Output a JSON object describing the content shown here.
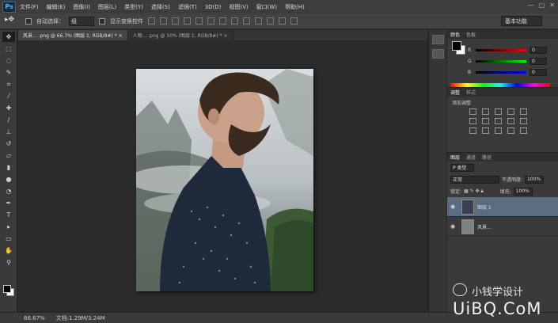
{
  "menubar": {
    "logo": "Ps",
    "items": [
      "文件(F)",
      "编辑(E)",
      "图像(I)",
      "图层(L)",
      "类型(Y)",
      "选择(S)",
      "滤镜(T)",
      "3D(D)",
      "视图(V)",
      "窗口(W)",
      "帮助(H)"
    ],
    "controls": [
      "—",
      "▢",
      "✕"
    ]
  },
  "options": {
    "auto_select": "自动选择：",
    "auto_select_value": "组",
    "show_transform": "显示变换控件",
    "workspace": "基本功能"
  },
  "tabs": [
    {
      "label": "风景... .png @ 66.7% (图层 1, RGB/8#) * ×",
      "active": true
    },
    {
      "label": "人物... .png @ 50% (图层 1, RGB/8#) * ×",
      "active": false
    }
  ],
  "panels": {
    "color_tabs": [
      "颜色",
      "色板"
    ],
    "sliders": [
      {
        "label": "R",
        "value": "0",
        "gradient": "linear-gradient(90deg,#000,#f00)"
      },
      {
        "label": "G",
        "value": "0",
        "gradient": "linear-gradient(90deg,#000,#0f0)"
      },
      {
        "label": "B",
        "value": "0",
        "gradient": "linear-gradient(90deg,#000,#00f)"
      }
    ],
    "adj_tabs": [
      "调整",
      "样式"
    ],
    "adj_title": "添加调整",
    "layers_tabs": [
      "图层",
      "通道",
      "路径"
    ],
    "kind": "P 类型",
    "blend_mode": "正常",
    "opacity_label": "不透明度:",
    "opacity": "100%",
    "lock_label": "锁定:",
    "fill_label": "填充:",
    "fill": "100%",
    "layers": [
      {
        "name": "图层 1",
        "selected": true
      },
      {
        "name": "风景...",
        "selected": false
      }
    ]
  },
  "status": {
    "zoom": "66.67%",
    "doc": "文档:1.29M/3.24M"
  },
  "watermark": {
    "line1": "小钱学设计",
    "line2": "UiBQ.CoM"
  },
  "colors": {
    "accent": "#5a6c80",
    "panel": "#3a3a3a",
    "canvas_bg": "#2b2b2b"
  }
}
